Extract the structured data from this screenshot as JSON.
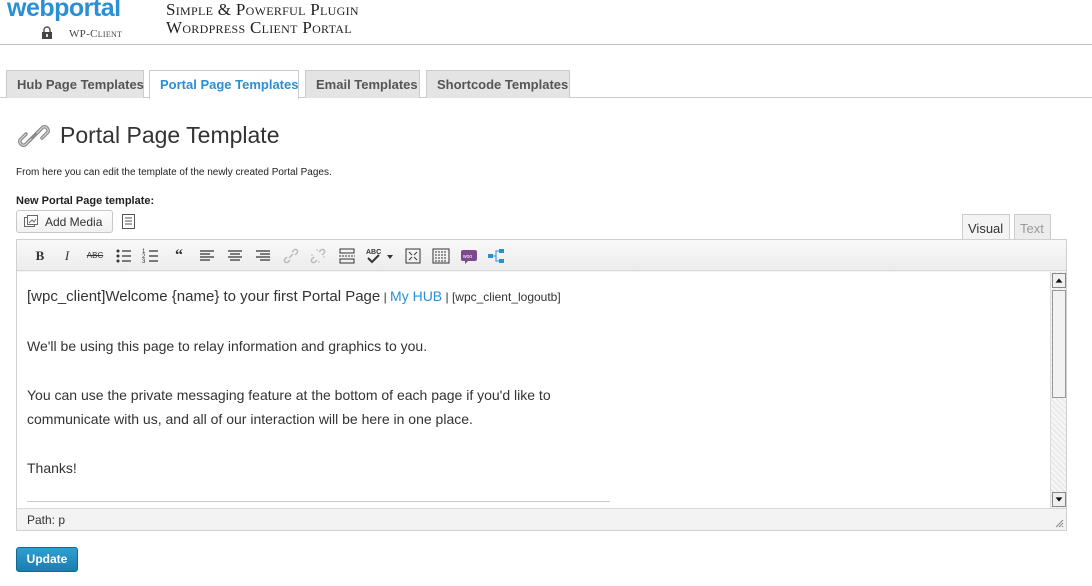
{
  "header": {
    "logo_text_1": "web",
    "logo_text_2": "portal",
    "logo_sub": "WP-Client",
    "tagline_line1": "Simple & Powerful Plugin",
    "tagline_line2": "Wordpress Client Portal"
  },
  "tabs": [
    {
      "label": "Hub Page Templates",
      "active": false
    },
    {
      "label": "Portal Page Templates",
      "active": true
    },
    {
      "label": "Email Templates",
      "active": false
    },
    {
      "label": "Shortcode Templates",
      "active": false
    }
  ],
  "page": {
    "title": "Portal Page Template",
    "description": "From here you can edit the template of the newly created Portal Pages.",
    "field_label": "New Portal Page template:"
  },
  "editor": {
    "add_media_label": "Add Media",
    "mode_visual": "Visual",
    "mode_text": "Text",
    "toolbar_icons": [
      "bold-icon",
      "italic-icon",
      "strikethrough-icon",
      "bullet-list-icon",
      "numbered-list-icon",
      "blockquote-icon",
      "align-left-icon",
      "align-center-icon",
      "align-right-icon",
      "link-icon",
      "unlink-icon",
      "insert-more-icon",
      "spellcheck-icon",
      "fullscreen-icon",
      "kitchen-sink-icon",
      "woo-icon",
      "sitemap-icon"
    ],
    "content": {
      "line1_shortcode": "[wpc_client]",
      "line1_text": "Welcome {name} to your first Portal Page",
      "line1_sep1": " | ",
      "line1_link": "My HUB",
      "line1_sep2": " | ",
      "line1_logout": "[wpc_client_logoutb]",
      "para2": "We'll be using this page to relay information and graphics to you.",
      "para3_line1": "You can use the private messaging feature at the bottom of each page if you'd like to",
      "para3_line2": "communicate with us, and all of our interaction will be here in one place.",
      "para4": "Thanks!"
    },
    "path": "Path: p"
  },
  "actions": {
    "update_label": "Update"
  },
  "colors": {
    "accent": "#2a8fd4",
    "button": "#2183b8"
  }
}
